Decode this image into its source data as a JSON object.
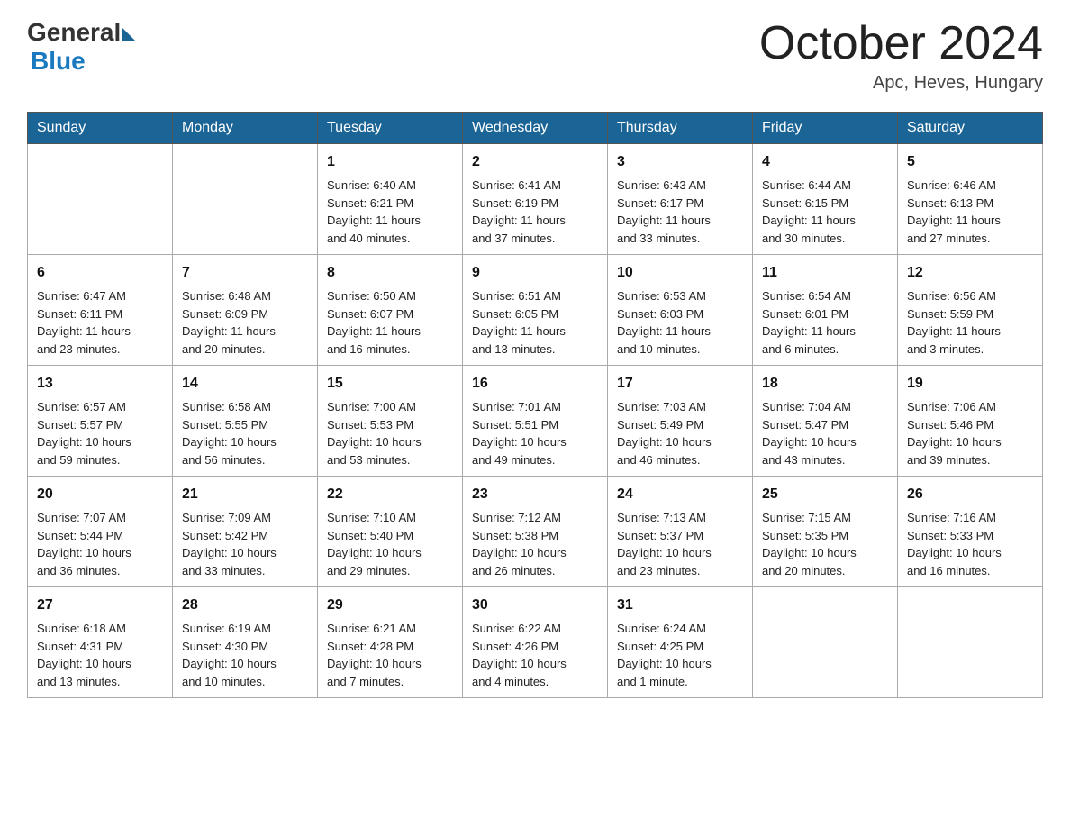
{
  "header": {
    "logo_general": "General",
    "logo_blue": "Blue",
    "month_title": "October 2024",
    "location": "Apc, Heves, Hungary"
  },
  "weekdays": [
    "Sunday",
    "Monday",
    "Tuesday",
    "Wednesday",
    "Thursday",
    "Friday",
    "Saturday"
  ],
  "weeks": [
    [
      {
        "day": "",
        "info": ""
      },
      {
        "day": "",
        "info": ""
      },
      {
        "day": "1",
        "info": "Sunrise: 6:40 AM\nSunset: 6:21 PM\nDaylight: 11 hours\nand 40 minutes."
      },
      {
        "day": "2",
        "info": "Sunrise: 6:41 AM\nSunset: 6:19 PM\nDaylight: 11 hours\nand 37 minutes."
      },
      {
        "day": "3",
        "info": "Sunrise: 6:43 AM\nSunset: 6:17 PM\nDaylight: 11 hours\nand 33 minutes."
      },
      {
        "day": "4",
        "info": "Sunrise: 6:44 AM\nSunset: 6:15 PM\nDaylight: 11 hours\nand 30 minutes."
      },
      {
        "day": "5",
        "info": "Sunrise: 6:46 AM\nSunset: 6:13 PM\nDaylight: 11 hours\nand 27 minutes."
      }
    ],
    [
      {
        "day": "6",
        "info": "Sunrise: 6:47 AM\nSunset: 6:11 PM\nDaylight: 11 hours\nand 23 minutes."
      },
      {
        "day": "7",
        "info": "Sunrise: 6:48 AM\nSunset: 6:09 PM\nDaylight: 11 hours\nand 20 minutes."
      },
      {
        "day": "8",
        "info": "Sunrise: 6:50 AM\nSunset: 6:07 PM\nDaylight: 11 hours\nand 16 minutes."
      },
      {
        "day": "9",
        "info": "Sunrise: 6:51 AM\nSunset: 6:05 PM\nDaylight: 11 hours\nand 13 minutes."
      },
      {
        "day": "10",
        "info": "Sunrise: 6:53 AM\nSunset: 6:03 PM\nDaylight: 11 hours\nand 10 minutes."
      },
      {
        "day": "11",
        "info": "Sunrise: 6:54 AM\nSunset: 6:01 PM\nDaylight: 11 hours\nand 6 minutes."
      },
      {
        "day": "12",
        "info": "Sunrise: 6:56 AM\nSunset: 5:59 PM\nDaylight: 11 hours\nand 3 minutes."
      }
    ],
    [
      {
        "day": "13",
        "info": "Sunrise: 6:57 AM\nSunset: 5:57 PM\nDaylight: 10 hours\nand 59 minutes."
      },
      {
        "day": "14",
        "info": "Sunrise: 6:58 AM\nSunset: 5:55 PM\nDaylight: 10 hours\nand 56 minutes."
      },
      {
        "day": "15",
        "info": "Sunrise: 7:00 AM\nSunset: 5:53 PM\nDaylight: 10 hours\nand 53 minutes."
      },
      {
        "day": "16",
        "info": "Sunrise: 7:01 AM\nSunset: 5:51 PM\nDaylight: 10 hours\nand 49 minutes."
      },
      {
        "day": "17",
        "info": "Sunrise: 7:03 AM\nSunset: 5:49 PM\nDaylight: 10 hours\nand 46 minutes."
      },
      {
        "day": "18",
        "info": "Sunrise: 7:04 AM\nSunset: 5:47 PM\nDaylight: 10 hours\nand 43 minutes."
      },
      {
        "day": "19",
        "info": "Sunrise: 7:06 AM\nSunset: 5:46 PM\nDaylight: 10 hours\nand 39 minutes."
      }
    ],
    [
      {
        "day": "20",
        "info": "Sunrise: 7:07 AM\nSunset: 5:44 PM\nDaylight: 10 hours\nand 36 minutes."
      },
      {
        "day": "21",
        "info": "Sunrise: 7:09 AM\nSunset: 5:42 PM\nDaylight: 10 hours\nand 33 minutes."
      },
      {
        "day": "22",
        "info": "Sunrise: 7:10 AM\nSunset: 5:40 PM\nDaylight: 10 hours\nand 29 minutes."
      },
      {
        "day": "23",
        "info": "Sunrise: 7:12 AM\nSunset: 5:38 PM\nDaylight: 10 hours\nand 26 minutes."
      },
      {
        "day": "24",
        "info": "Sunrise: 7:13 AM\nSunset: 5:37 PM\nDaylight: 10 hours\nand 23 minutes."
      },
      {
        "day": "25",
        "info": "Sunrise: 7:15 AM\nSunset: 5:35 PM\nDaylight: 10 hours\nand 20 minutes."
      },
      {
        "day": "26",
        "info": "Sunrise: 7:16 AM\nSunset: 5:33 PM\nDaylight: 10 hours\nand 16 minutes."
      }
    ],
    [
      {
        "day": "27",
        "info": "Sunrise: 6:18 AM\nSunset: 4:31 PM\nDaylight: 10 hours\nand 13 minutes."
      },
      {
        "day": "28",
        "info": "Sunrise: 6:19 AM\nSunset: 4:30 PM\nDaylight: 10 hours\nand 10 minutes."
      },
      {
        "day": "29",
        "info": "Sunrise: 6:21 AM\nSunset: 4:28 PM\nDaylight: 10 hours\nand 7 minutes."
      },
      {
        "day": "30",
        "info": "Sunrise: 6:22 AM\nSunset: 4:26 PM\nDaylight: 10 hours\nand 4 minutes."
      },
      {
        "day": "31",
        "info": "Sunrise: 6:24 AM\nSunset: 4:25 PM\nDaylight: 10 hours\nand 1 minute."
      },
      {
        "day": "",
        "info": ""
      },
      {
        "day": "",
        "info": ""
      }
    ]
  ]
}
